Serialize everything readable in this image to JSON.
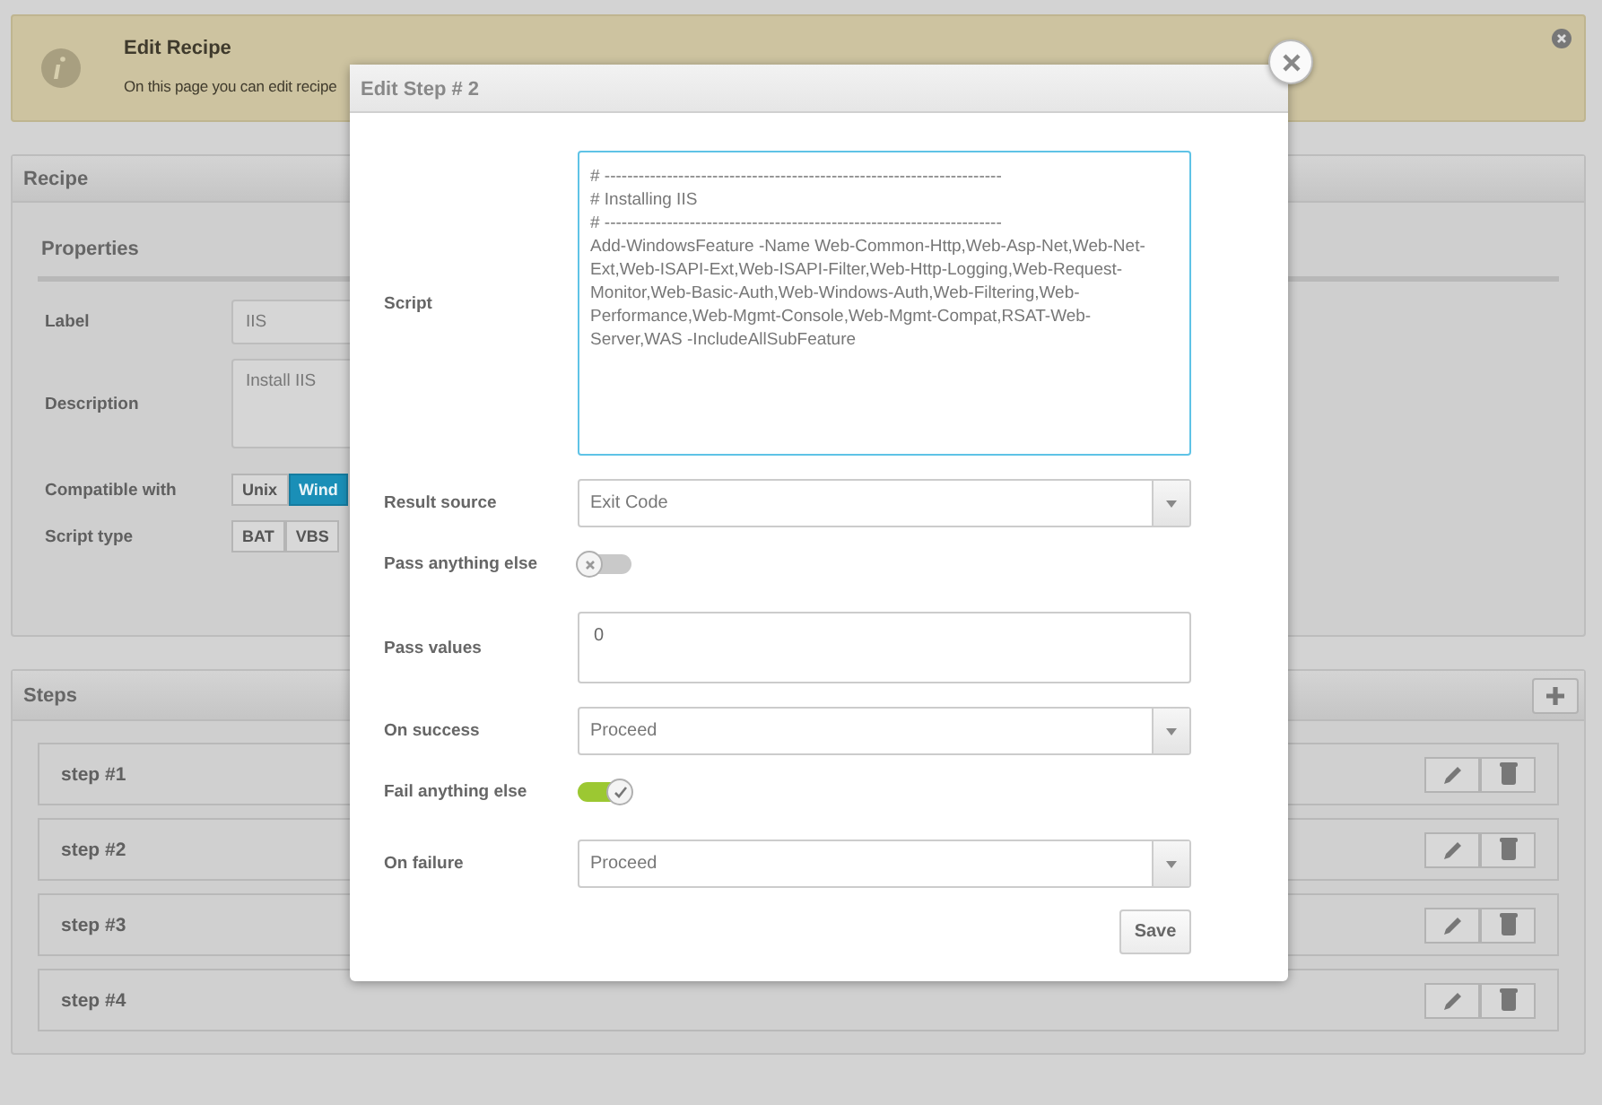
{
  "alert": {
    "title": "Edit Recipe",
    "text": "On this page you can edit recipe"
  },
  "recipe": {
    "title": "Recipe",
    "properties": {
      "title": "Properties",
      "fields": [
        {
          "kind": "input",
          "label": "Label",
          "value": "IIS"
        },
        {
          "kind": "textarea",
          "label": "Description",
          "value": "Install IIS"
        },
        {
          "kind": "segmented",
          "label": "Compatible with",
          "options": [
            {
              "label": "Unix",
              "selected": false
            },
            {
              "label": "Wind",
              "selected": true
            }
          ]
        },
        {
          "kind": "segmented",
          "label": "Script type",
          "options": [
            {
              "label": "BAT",
              "selected": false
            },
            {
              "label": "VBS",
              "selected": false
            }
          ]
        }
      ]
    }
  },
  "steps": {
    "title": "Steps",
    "items": [
      {
        "name": "step #1"
      },
      {
        "name": "step #2"
      },
      {
        "name": "step #3"
      },
      {
        "name": "step #4"
      }
    ]
  },
  "dialog": {
    "title": "Edit Step # 2",
    "fields": [
      {
        "kind": "code",
        "label": "Script",
        "value": "# ----------------------------------------------------------------------\n# Installing IIS\n# ----------------------------------------------------------------------\nAdd-WindowsFeature -Name Web-Common-Http,Web-Asp-Net,Web-Net-Ext,Web-ISAPI-Ext,Web-ISAPI-Filter,Web-Http-Logging,Web-Request-Monitor,Web-Basic-Auth,Web-Windows-Auth,Web-Filtering,Web-Performance,Web-Mgmt-Console,Web-Mgmt-Compat,RSAT-Web-Server,WAS -IncludeAllSubFeature"
      },
      {
        "kind": "select",
        "label": "Result source",
        "value": "Exit Code"
      },
      {
        "kind": "toggle",
        "label": "Pass anything else",
        "on": false
      },
      {
        "kind": "textarea",
        "label": "Pass values",
        "value": "0"
      },
      {
        "kind": "select",
        "label": "On success",
        "value": "Proceed"
      },
      {
        "kind": "toggle",
        "label": "Fail anything else",
        "on": true
      },
      {
        "kind": "select",
        "label": "On failure",
        "value": "Proceed"
      }
    ],
    "button": "Save"
  }
}
